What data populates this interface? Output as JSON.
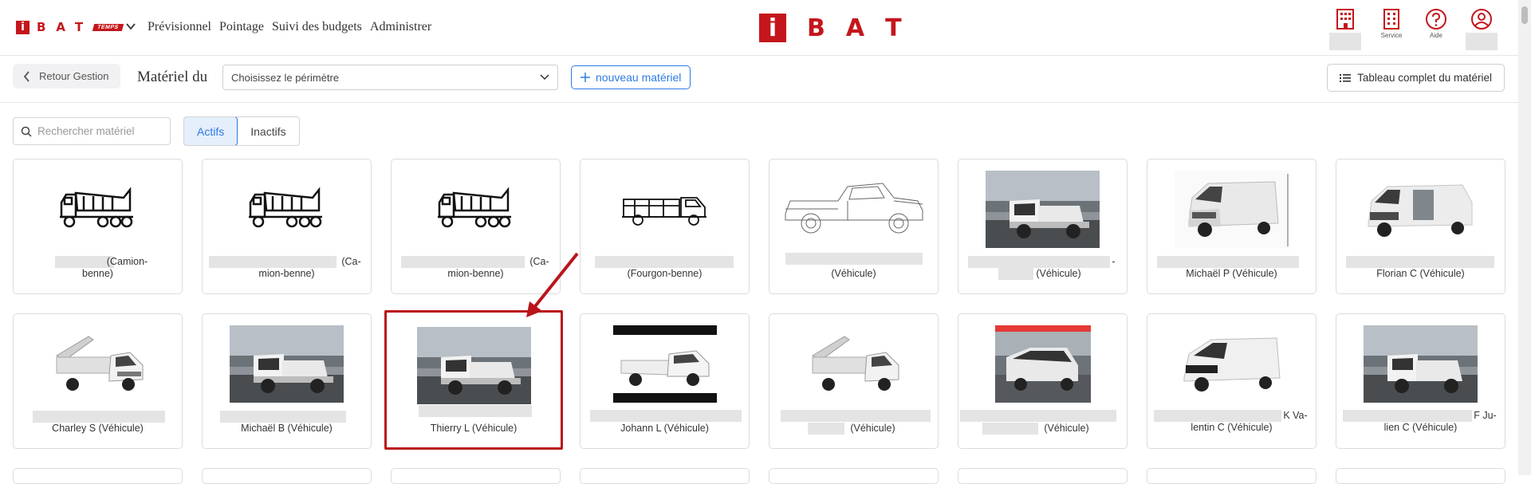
{
  "brand": {
    "letter": "i",
    "rest": "BAT",
    "tag": "TEMPS"
  },
  "nav": [
    "Prévisionnel",
    "Pointage",
    "Suivi des budgets",
    "Administrer"
  ],
  "center_logo": {
    "letter": "i",
    "l1": "B",
    "l2": "A",
    "l3": "T"
  },
  "top_icons": {
    "service_label": "Service",
    "aide_label": "Aide"
  },
  "toolbar": {
    "back_label": "Retour Gestion",
    "materiel_du": "Matériel du",
    "perimeter_placeholder": "Choisissez le périmètre",
    "new_label": "nouveau matériel",
    "full_table_label": "Tableau complet du matériel"
  },
  "filters": {
    "search_placeholder": "Rechercher matériel",
    "tabs": [
      "Actifs",
      "Inactifs"
    ],
    "active_tab": "Actifs"
  },
  "cards_row1": [
    {
      "line1": "(Camion-",
      "line2": "benne)"
    },
    {
      "line1": "(Ca-",
      "line2": "mion-benne)"
    },
    {
      "line1": "(Ca-",
      "line2": "mion-benne)"
    },
    {
      "line1": "",
      "line2": "(Fourgon-benne)"
    },
    {
      "line1": "",
      "line2": "(Véhicule)"
    },
    {
      "line1": "-",
      "line2": "(Véhicule)"
    },
    {
      "line1": "",
      "line2": "Michaël P (Véhicule)"
    },
    {
      "line1": "",
      "line2": "Florian C (Véhicule)"
    }
  ],
  "cards_row2": [
    {
      "line1": "",
      "line2": "Charley S (Véhicule)"
    },
    {
      "line1": "",
      "line2": "Michaël B (Véhicule)"
    },
    {
      "line1": "",
      "line2": "Thierry L (Véhicule)"
    },
    {
      "line1": "",
      "line2": "Johann L (Véhicule)"
    },
    {
      "line1": "",
      "line2": "(Véhicule)"
    },
    {
      "line1": "",
      "line2": "(Véhicule)"
    },
    {
      "line1": "K Va-",
      "line2": "lentin C (Véhicule)"
    },
    {
      "line1": "F Ju-",
      "line2": "lien C (Véhicule)"
    }
  ],
  "colors": {
    "brand_red": "#c4161c",
    "accent_blue": "#2d7be5",
    "highlight_red": "#b9151b"
  }
}
